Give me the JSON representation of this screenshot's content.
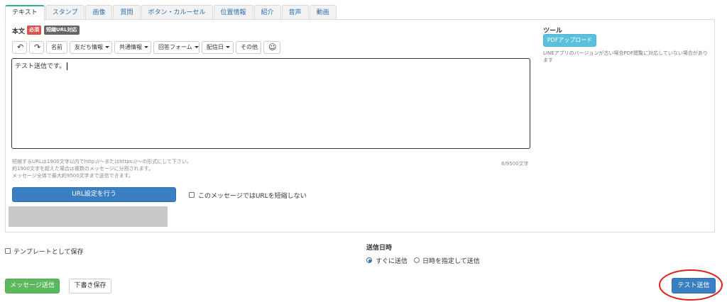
{
  "tabs": [
    "テキスト",
    "スタンプ",
    "画像",
    "質問",
    "ボタン・カルーセル",
    "位置情報",
    "紹介",
    "音声",
    "動画"
  ],
  "editor": {
    "label": "本文",
    "required_badge": "必須",
    "short_url_badge": "短縮URL対応",
    "toolbar": {
      "undo_icon": "↶",
      "redo_icon": "↷",
      "name": "名前",
      "friend_info": "友だち情報",
      "shared_info": "共通情報",
      "answer_form": "回答フォーム",
      "delivery_date": "配信日",
      "other": "その他",
      "emoji_icon": "☺"
    },
    "message_text": "テスト送信です。",
    "notes": [
      "短縮するURLは1900文字以内でhttp://〜またはhttps://〜の形式にして下さい。",
      "約1900文字を超えた場合は複数のメッセージに分割されます。",
      "メッセージ全体で最大約9500文字まで送信できます。"
    ],
    "char_count": "8/9500文字",
    "url_settings_button": "URL設定を行う",
    "no_shorten_label": "このメッセージではURLを短縮しない"
  },
  "tools": {
    "title": "ツール",
    "pdf_button": "PDFアップロード",
    "note": "LINEアプリのバージョンが古い場合PDF閲覧に対応していない場合があります"
  },
  "template_save_label": "テンプレートとして保存",
  "schedule": {
    "title": "送信日時",
    "option_now": "すぐに送信",
    "option_date": "日時を指定して送信"
  },
  "actions": {
    "send_message": "メッセージ送信",
    "save_draft": "下書き保存",
    "test_send": "テスト送信"
  },
  "colors": {
    "primary": "#3a7fc1",
    "info": "#5bc0de",
    "success": "#5cb85c",
    "required": "#d9534f",
    "highlight_circle": "#e0201b"
  }
}
